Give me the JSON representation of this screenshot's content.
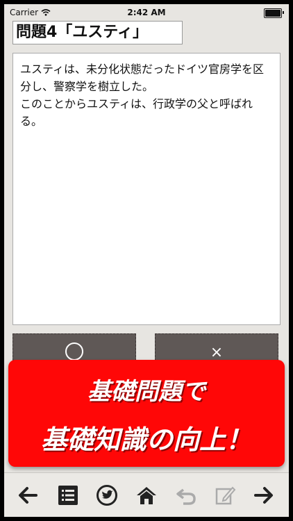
{
  "status_bar": {
    "carrier": "Carrier",
    "time": "2:42 AM"
  },
  "question": {
    "title": "問題4「ユスティ」",
    "body": "ユスティは、未分化状態だったドイツ官房学を区分し、警察学を樹立した。\nこのことからユスティは、行政学の父と呼ばれる。"
  },
  "answers": {
    "correct": {
      "label": "○",
      "icon": "circle-icon"
    },
    "wrong": {
      "label": "×",
      "icon": "cross-icon"
    }
  },
  "banner": {
    "line1": "基礎問題で",
    "line2": "基礎知識の向上！",
    "color": "#ff0707"
  },
  "toolbar": {
    "items": [
      {
        "icon": "back-arrow-icon",
        "enabled": true
      },
      {
        "icon": "list-icon",
        "enabled": true
      },
      {
        "icon": "twitter-icon",
        "enabled": true
      },
      {
        "icon": "home-icon",
        "enabled": true
      },
      {
        "icon": "undo-icon",
        "enabled": false
      },
      {
        "icon": "edit-icon",
        "enabled": false
      },
      {
        "icon": "forward-arrow-icon",
        "enabled": true
      }
    ]
  }
}
